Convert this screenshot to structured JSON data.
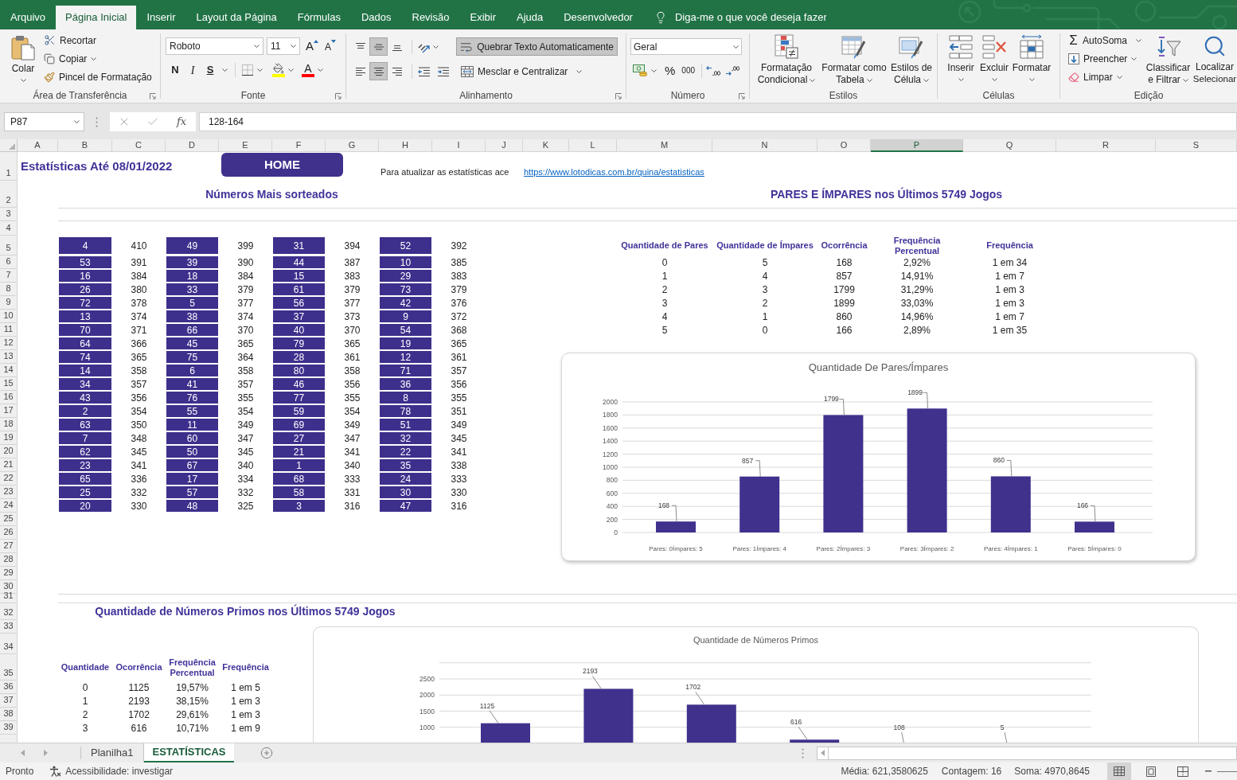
{
  "ribbon_tabs": [
    {
      "label": "Arquivo",
      "selected": false
    },
    {
      "label": "Página Inicial",
      "selected": true
    },
    {
      "label": "Inserir",
      "selected": false
    },
    {
      "label": "Layout da Página",
      "selected": false
    },
    {
      "label": "Fórmulas",
      "selected": false
    },
    {
      "label": "Dados",
      "selected": false
    },
    {
      "label": "Revisão",
      "selected": false
    },
    {
      "label": "Exibir",
      "selected": false
    },
    {
      "label": "Ajuda",
      "selected": false
    },
    {
      "label": "Desenvolvedor",
      "selected": false
    }
  ],
  "tell_me": {
    "placeholder": "Diga-me o que você deseja fazer"
  },
  "clipboard_group": {
    "label": "Área de Transferência",
    "paste": "Colar",
    "cut": "Recortar",
    "copy": "Copiar",
    "format_painter": "Pincel de Formatação"
  },
  "font_group": {
    "label": "Fonte",
    "font_name": "Roboto",
    "font_size": "11",
    "grow_font": "A",
    "shrink_font": "A",
    "bold": "N",
    "italic": "I",
    "underline": "S",
    "font_color": "A"
  },
  "alignment_group": {
    "label": "Alinhamento",
    "vertical_align": [
      {
        "kind": "top",
        "selected": false
      },
      {
        "kind": "middle",
        "selected": true
      },
      {
        "kind": "bottom",
        "selected": false
      }
    ],
    "horizontal_align": [
      {
        "kind": "left",
        "selected": false
      },
      {
        "kind": "center",
        "selected": true
      },
      {
        "kind": "right",
        "selected": false
      }
    ],
    "wrap_text": {
      "label": "Quebrar Texto Automaticamente",
      "on": true
    },
    "merge": "Mesclar e Centralizar"
  },
  "number_group": {
    "label": "Número",
    "format": "Geral",
    "percent": "%",
    "thousands": "000"
  },
  "styles_group": {
    "label": "Estilos",
    "buttons": [
      {
        "kind": "conditional",
        "lines": [
          "Formatação",
          "Condicional"
        ]
      },
      {
        "kind": "table",
        "lines": [
          "Formatar como",
          "Tabela"
        ]
      },
      {
        "kind": "cell",
        "lines": [
          "Estilos de",
          "Célula"
        ]
      }
    ]
  },
  "cells_group": {
    "label": "Células",
    "buttons": [
      {
        "kind": "insert",
        "label": "Inserir"
      },
      {
        "kind": "delete",
        "label": "Excluir"
      },
      {
        "kind": "format",
        "label": "Formatar"
      }
    ]
  },
  "editing_group": {
    "label": "Edição",
    "autosum_symbol": "Σ",
    "autosum": "AutoSoma",
    "fill": "Preencher",
    "clear": "Limpar",
    "sort_filter": [
      "Classificar",
      "e Filtrar"
    ],
    "find": [
      "Localizar",
      "Selecionar"
    ]
  },
  "formula_bar": {
    "name_box": "P87",
    "function_symbol": "fx",
    "formula": "128-164"
  },
  "column_headers": [
    {
      "label": "A",
      "selected": false
    },
    {
      "label": "B",
      "selected": false
    },
    {
      "label": "C",
      "selected": false
    },
    {
      "label": "D",
      "selected": false
    },
    {
      "label": "E",
      "selected": false
    },
    {
      "label": "F",
      "selected": false
    },
    {
      "label": "G",
      "selected": false
    },
    {
      "label": "H",
      "selected": false
    },
    {
      "label": "I",
      "selected": false
    },
    {
      "label": "J",
      "selected": false
    },
    {
      "label": "K",
      "selected": false
    },
    {
      "label": "L",
      "selected": false
    },
    {
      "label": "M",
      "selected": false
    },
    {
      "label": "N",
      "selected": false
    },
    {
      "label": "O",
      "selected": false
    },
    {
      "label": "P",
      "selected": true
    },
    {
      "label": "Q",
      "selected": false
    },
    {
      "label": "R",
      "selected": false
    },
    {
      "label": "S",
      "selected": false
    }
  ],
  "row_numbers": [
    "1",
    "2",
    "3",
    "4",
    "5",
    "6",
    "7",
    "8",
    "9",
    "10",
    "11",
    "12",
    "13",
    "14",
    "15",
    "16",
    "17",
    "18",
    "19",
    "20",
    "21",
    "22",
    "23",
    "24",
    "25",
    "26",
    "27",
    "28",
    "29",
    "30",
    "31",
    "32",
    "33",
    "34",
    "35",
    "36",
    "37",
    "38",
    "39"
  ],
  "sheet": {
    "title": "Estatísticas Até 08/01/2022",
    "home_button": "HOME",
    "update_note": "Para atualizar as estatísticas ace",
    "update_link": "https://www.lotodicas.com.br/quina/estatisticas",
    "most_drawn": {
      "title": "Números Mais sorteados",
      "rows": [
        [
          [
            "4",
            "410"
          ],
          [
            "49",
            "399"
          ],
          [
            "31",
            "394"
          ],
          [
            "52",
            "392"
          ]
        ],
        [
          [
            "53",
            "391"
          ],
          [
            "39",
            "390"
          ],
          [
            "44",
            "387"
          ],
          [
            "10",
            "385"
          ]
        ],
        [
          [
            "16",
            "384"
          ],
          [
            "18",
            "384"
          ],
          [
            "15",
            "383"
          ],
          [
            "29",
            "383"
          ]
        ],
        [
          [
            "26",
            "380"
          ],
          [
            "33",
            "379"
          ],
          [
            "61",
            "379"
          ],
          [
            "73",
            "379"
          ]
        ],
        [
          [
            "72",
            "378"
          ],
          [
            "5",
            "377"
          ],
          [
            "56",
            "377"
          ],
          [
            "42",
            "376"
          ]
        ],
        [
          [
            "13",
            "374"
          ],
          [
            "38",
            "374"
          ],
          [
            "37",
            "373"
          ],
          [
            "9",
            "372"
          ]
        ],
        [
          [
            "70",
            "371"
          ],
          [
            "66",
            "370"
          ],
          [
            "40",
            "370"
          ],
          [
            "54",
            "368"
          ]
        ],
        [
          [
            "64",
            "366"
          ],
          [
            "45",
            "365"
          ],
          [
            "79",
            "365"
          ],
          [
            "19",
            "365"
          ]
        ],
        [
          [
            "74",
            "365"
          ],
          [
            "75",
            "364"
          ],
          [
            "28",
            "361"
          ],
          [
            "12",
            "361"
          ]
        ],
        [
          [
            "14",
            "358"
          ],
          [
            "6",
            "358"
          ],
          [
            "80",
            "358"
          ],
          [
            "71",
            "357"
          ]
        ],
        [
          [
            "34",
            "357"
          ],
          [
            "41",
            "357"
          ],
          [
            "46",
            "356"
          ],
          [
            "36",
            "356"
          ]
        ],
        [
          [
            "43",
            "356"
          ],
          [
            "76",
            "355"
          ],
          [
            "77",
            "355"
          ],
          [
            "8",
            "355"
          ]
        ],
        [
          [
            "2",
            "354"
          ],
          [
            "55",
            "354"
          ],
          [
            "59",
            "354"
          ],
          [
            "78",
            "351"
          ]
        ],
        [
          [
            "63",
            "350"
          ],
          [
            "11",
            "349"
          ],
          [
            "69",
            "349"
          ],
          [
            "51",
            "349"
          ]
        ],
        [
          [
            "7",
            "348"
          ],
          [
            "60",
            "347"
          ],
          [
            "27",
            "347"
          ],
          [
            "32",
            "345"
          ]
        ],
        [
          [
            "62",
            "345"
          ],
          [
            "50",
            "345"
          ],
          [
            "21",
            "341"
          ],
          [
            "22",
            "341"
          ]
        ],
        [
          [
            "23",
            "341"
          ],
          [
            "67",
            "340"
          ],
          [
            "1",
            "340"
          ],
          [
            "35",
            "338"
          ]
        ],
        [
          [
            "65",
            "336"
          ],
          [
            "17",
            "334"
          ],
          [
            "68",
            "333"
          ],
          [
            "24",
            "333"
          ]
        ],
        [
          [
            "25",
            "332"
          ],
          [
            "57",
            "332"
          ],
          [
            "58",
            "331"
          ],
          [
            "30",
            "330"
          ]
        ],
        [
          [
            "20",
            "330"
          ],
          [
            "48",
            "325"
          ],
          [
            "3",
            "316"
          ],
          [
            "47",
            "316"
          ]
        ]
      ]
    },
    "even_odd": {
      "title": "PARES E ÍMPARES nos Últimos 5749 Jogos",
      "columns": [
        "Quantidade de Pares",
        "Quantidade de Ímpares",
        "Ocorrência",
        "Frequência Percentual",
        "Frequência"
      ],
      "rows": [
        [
          "0",
          "5",
          "168",
          "2,92%",
          "1 em 34"
        ],
        [
          "1",
          "4",
          "857",
          "14,91%",
          "1 em 7"
        ],
        [
          "2",
          "3",
          "1799",
          "31,29%",
          "1 em 3"
        ],
        [
          "3",
          "2",
          "1899",
          "33,03%",
          "1 em 3"
        ],
        [
          "4",
          "1",
          "860",
          "14,96%",
          "1 em 7"
        ],
        [
          "5",
          "0",
          "166",
          "2,89%",
          "1 em 35"
        ]
      ],
      "chart_data": {
        "type": "bar",
        "title": "Quantidade De Pares/Ímpares",
        "categories": [
          "Pares: 0Ímpares: 5",
          "Pares: 1Ímpares: 4",
          "Pares: 2Ímpares: 3",
          "Pares: 3Ímpares: 2",
          "Pares: 4Ímpares: 1",
          "Pares: 5Ímpares: 0"
        ],
        "series": [
          {
            "color": "#40318d",
            "values": [
              168,
              857,
              1799,
              1899,
              860,
              166
            ]
          }
        ],
        "ylim": [
          0,
          2000
        ],
        "yticks": [
          0,
          200,
          400,
          600,
          800,
          1000,
          1200,
          1400,
          1600,
          1800,
          2000
        ],
        "grid": true,
        "data_labels": true
      }
    },
    "primes": {
      "title": "Quantidade de Números Primos nos Últimos 5749 Jogos",
      "columns": [
        "Quantidade",
        "Ocorrência",
        "Frequência Percentual",
        "Frequência"
      ],
      "rows": [
        [
          "0",
          "1125",
          "19,57%",
          "1 em 5"
        ],
        [
          "1",
          "2193",
          "38,15%",
          "1 em 3"
        ],
        [
          "2",
          "1702",
          "29,61%",
          "1 em 3"
        ],
        [
          "3",
          "616",
          "10,71%",
          "1 em 9"
        ]
      ],
      "chart_data": {
        "type": "bar",
        "title": "Quantidade de Números Primos",
        "categories": [
          null,
          null,
          null,
          null,
          null,
          null
        ],
        "series": [
          {
            "color": "#40318d",
            "values": [
              1125,
              2193,
              1702,
              616,
              null,
              null
            ]
          }
        ],
        "ylim": [
          500,
          3000
        ],
        "yticks": [
          1000,
          1500,
          2000,
          2500
        ],
        "grid": true,
        "data_labels": true,
        "annotations": [
          "108",
          "5"
        ]
      }
    }
  },
  "sheet_tabs": [
    {
      "label": "Planilha1",
      "selected": false
    },
    {
      "label": "ESTATÍSTICAS",
      "selected": true
    }
  ],
  "status_bar": {
    "ready": "Pronto",
    "accessibility": "Acessibilidade: investigar",
    "average": "Média: 621,3580625",
    "count": "Contagem: 16",
    "sum": "Soma: 4970,8645",
    "views": [
      {
        "kind": "normal",
        "selected": true
      },
      {
        "kind": "page_layout",
        "selected": false
      },
      {
        "kind": "page_break",
        "selected": false
      }
    ]
  }
}
